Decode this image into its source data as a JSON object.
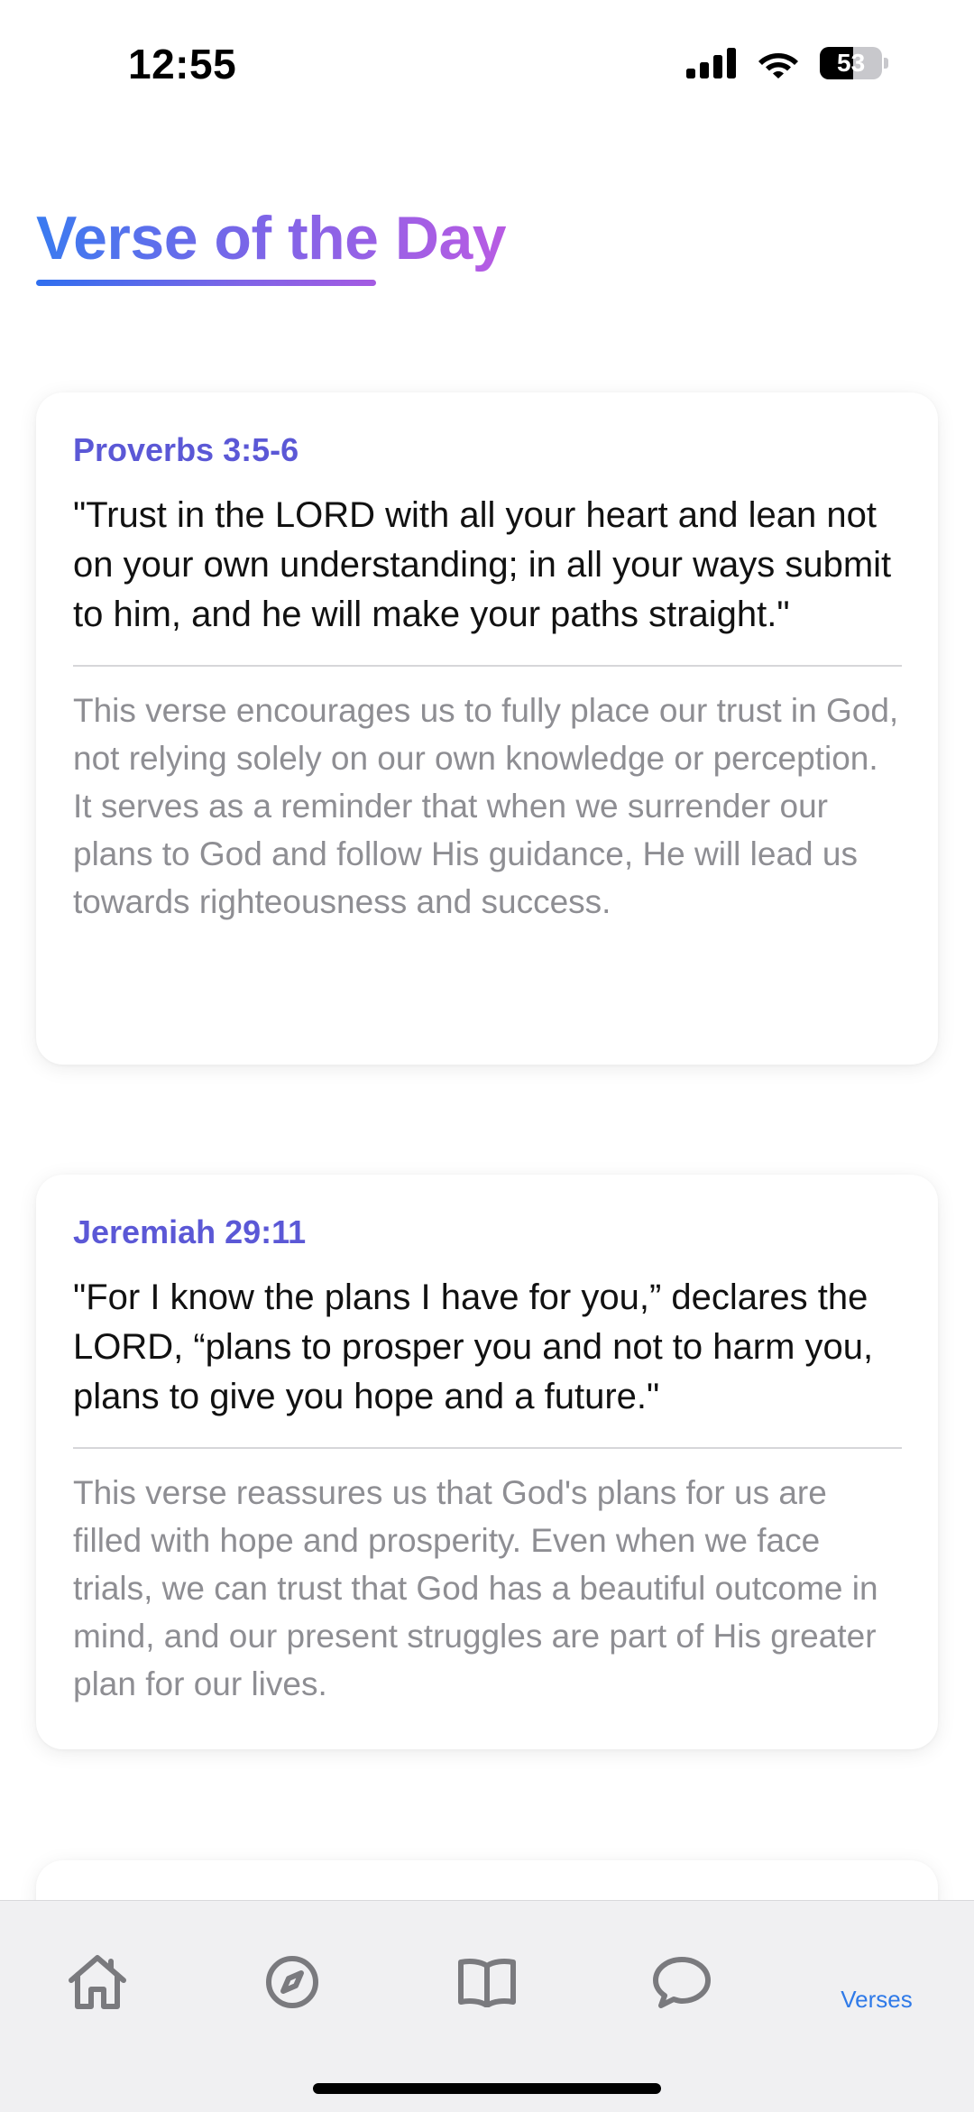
{
  "status_bar": {
    "time": "12:55",
    "battery_level": "53",
    "battery_fraction": 0.53,
    "icons": [
      "cellular-signal-icon",
      "wifi-icon",
      "battery-icon"
    ]
  },
  "page": {
    "title": "Verse of the Day",
    "title_gradient": [
      "#3A7BF0",
      "#B85BE3"
    ]
  },
  "verses": [
    {
      "reference": "Proverbs 3:5-6",
      "text": "\"Trust in the LORD with all your heart and lean not on your own understanding; in all your ways submit to him, and he will make your paths straight.\"",
      "reflection": "This verse encourages us to fully place our trust in God, not relying solely on our own knowledge or perception. It serves as a reminder that when we surrender our plans to God and follow His guidance, He will lead us towards righteousness and success."
    },
    {
      "reference": "Jeremiah 29:11",
      "text": "\"For I know the plans I have for you,” declares the LORD, “plans to prosper you and not to harm you, plans to give you hope and a future.\"",
      "reflection": "This verse reassures us that God's plans for us are filled with hope and prosperity. Even when we face trials, we can trust that God has a beautiful outcome in mind, and our present struggles are part of His greater plan for our lives."
    }
  ],
  "tab_bar": {
    "tabs": [
      {
        "icon": "home-icon"
      },
      {
        "icon": "compass-icon"
      },
      {
        "icon": "book-icon"
      },
      {
        "icon": "chat-bubble-icon"
      },
      {
        "label": "Verses",
        "active": true
      }
    ],
    "active_color": "#2F7AE8",
    "inactive_color": "#7A7A7E"
  },
  "colors": {
    "reference": "#5B58D6",
    "verse_text": "#111111",
    "reflection_text": "#8E8E93",
    "tab_bar_bg": "#F0F0F2"
  }
}
